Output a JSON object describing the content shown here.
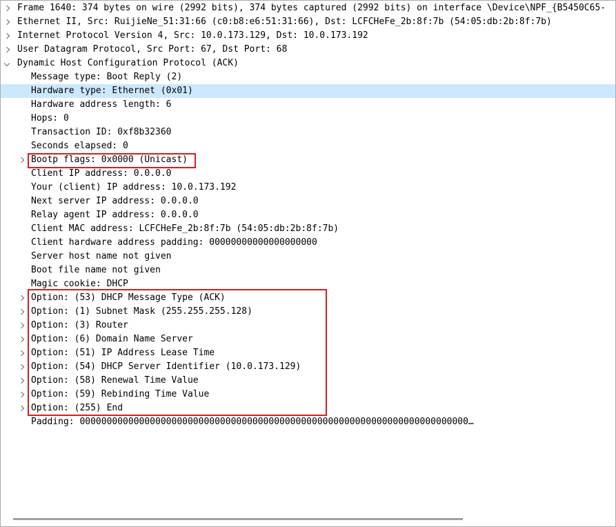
{
  "rows": [
    {
      "text": "Frame 1640: 374 bytes on wire (2992 bits), 374 bytes captured (2992 bits) on interface \\Device\\NPF_{B5450C65-",
      "level": 0,
      "expander": "collapsed"
    },
    {
      "text": "Ethernet II, Src: RuijieNe_51:31:66 (c0:b8:e6:51:31:66), Dst: LCFCHeFe_2b:8f:7b (54:05:db:2b:8f:7b)",
      "level": 0,
      "expander": "collapsed"
    },
    {
      "text": "Internet Protocol Version 4, Src: 10.0.173.129, Dst: 10.0.173.192",
      "level": 0,
      "expander": "collapsed"
    },
    {
      "text": "User Datagram Protocol, Src Port: 67, Dst Port: 68",
      "level": 0,
      "expander": "collapsed"
    },
    {
      "text": "Dynamic Host Configuration Protocol (ACK)",
      "level": 0,
      "expander": "expanded"
    },
    {
      "text": "Message type: Boot Reply (2)",
      "level": 1,
      "expander": "none"
    },
    {
      "text": "Hardware type: Ethernet (0x01)",
      "level": 1,
      "expander": "none",
      "selected": true
    },
    {
      "text": "Hardware address length: 6",
      "level": 1,
      "expander": "none"
    },
    {
      "text": "Hops: 0",
      "level": 1,
      "expander": "none"
    },
    {
      "text": "Transaction ID: 0xf8b32360",
      "level": 1,
      "expander": "none"
    },
    {
      "text": "Seconds elapsed: 0",
      "level": 1,
      "expander": "none"
    },
    {
      "text": "Bootp flags: 0x0000 (Unicast)",
      "level": 1,
      "expander": "collapsed"
    },
    {
      "text": "Client IP address: 0.0.0.0",
      "level": 1,
      "expander": "none"
    },
    {
      "text": "Your (client) IP address: 10.0.173.192",
      "level": 1,
      "expander": "none"
    },
    {
      "text": "Next server IP address: 0.0.0.0",
      "level": 1,
      "expander": "none"
    },
    {
      "text": "Relay agent IP address: 0.0.0.0",
      "level": 1,
      "expander": "none"
    },
    {
      "text": "Client MAC address: LCFCHeFe_2b:8f:7b (54:05:db:2b:8f:7b)",
      "level": 1,
      "expander": "none"
    },
    {
      "text": "Client hardware address padding: 00000000000000000000",
      "level": 1,
      "expander": "none"
    },
    {
      "text": "Server host name not given",
      "level": 1,
      "expander": "none"
    },
    {
      "text": "Boot file name not given",
      "level": 1,
      "expander": "none"
    },
    {
      "text": "Magic cookie: DHCP",
      "level": 1,
      "expander": "none"
    },
    {
      "text": "Option: (53) DHCP Message Type (ACK)",
      "level": 1,
      "expander": "collapsed"
    },
    {
      "text": "Option: (1) Subnet Mask (255.255.255.128)",
      "level": 1,
      "expander": "collapsed"
    },
    {
      "text": "Option: (3) Router",
      "level": 1,
      "expander": "collapsed"
    },
    {
      "text": "Option: (6) Domain Name Server",
      "level": 1,
      "expander": "collapsed"
    },
    {
      "text": "Option: (51) IP Address Lease Time",
      "level": 1,
      "expander": "collapsed"
    },
    {
      "text": "Option: (54) DHCP Server Identifier (10.0.173.129)",
      "level": 1,
      "expander": "collapsed"
    },
    {
      "text": "Option: (58) Renewal Time Value",
      "level": 1,
      "expander": "collapsed"
    },
    {
      "text": "Option: (59) Rebinding Time Value",
      "level": 1,
      "expander": "collapsed"
    },
    {
      "text": "Option: (255) End",
      "level": 1,
      "expander": "collapsed"
    },
    {
      "text": "Padding: 000000000000000000000000000000000000000000000000000000000000000000000000…",
      "level": 1,
      "expander": "none"
    }
  ],
  "highlight_color": "#d91c1c",
  "selection_color": "#cce8ff"
}
